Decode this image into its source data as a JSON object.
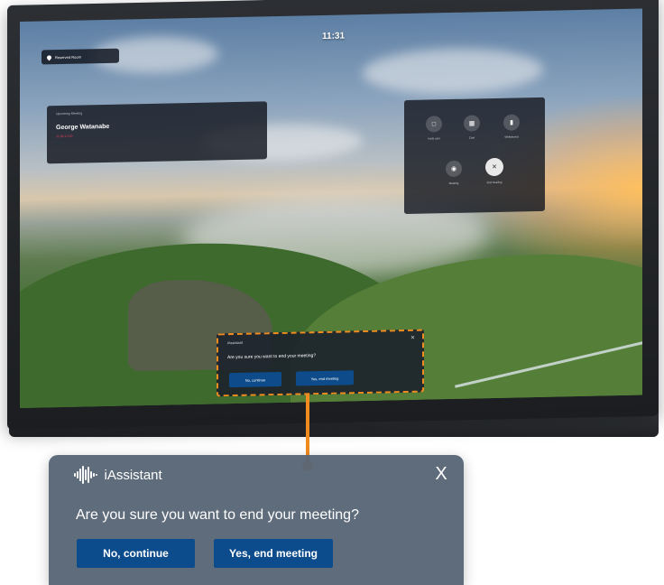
{
  "screen": {
    "clock": "11:31",
    "room_label": "Reserved Room",
    "meeting": {
      "label": "Upcoming Meeting",
      "name": "George Watanabe",
      "time": "11:00-12:00"
    },
    "quick_actions": [
      {
        "label": "Invite user",
        "icon": "invite-icon"
      },
      {
        "label": "Cast",
        "icon": "cast-icon"
      },
      {
        "label": "Whiteboard",
        "icon": "whiteboard-icon"
      },
      {
        "label": "Meeting",
        "icon": "meeting-icon"
      },
      {
        "label": "End meeting",
        "icon": "close-icon"
      }
    ],
    "mini_dialog": {
      "title": "iAssistant",
      "question": "Are you sure you want to end your meeting?",
      "continue_label": "No, continue",
      "end_label": "Yes, end meeting"
    }
  },
  "dialog": {
    "title": "iAssistant",
    "question": "Are you sure you want to end your meeting?",
    "close_label": "X",
    "continue_label": "No, continue",
    "end_label": "Yes, end meeting"
  },
  "colors": {
    "accent_callout": "#ef8b1f",
    "button": "#0d4c8c",
    "dialog_bg": "#586676"
  }
}
